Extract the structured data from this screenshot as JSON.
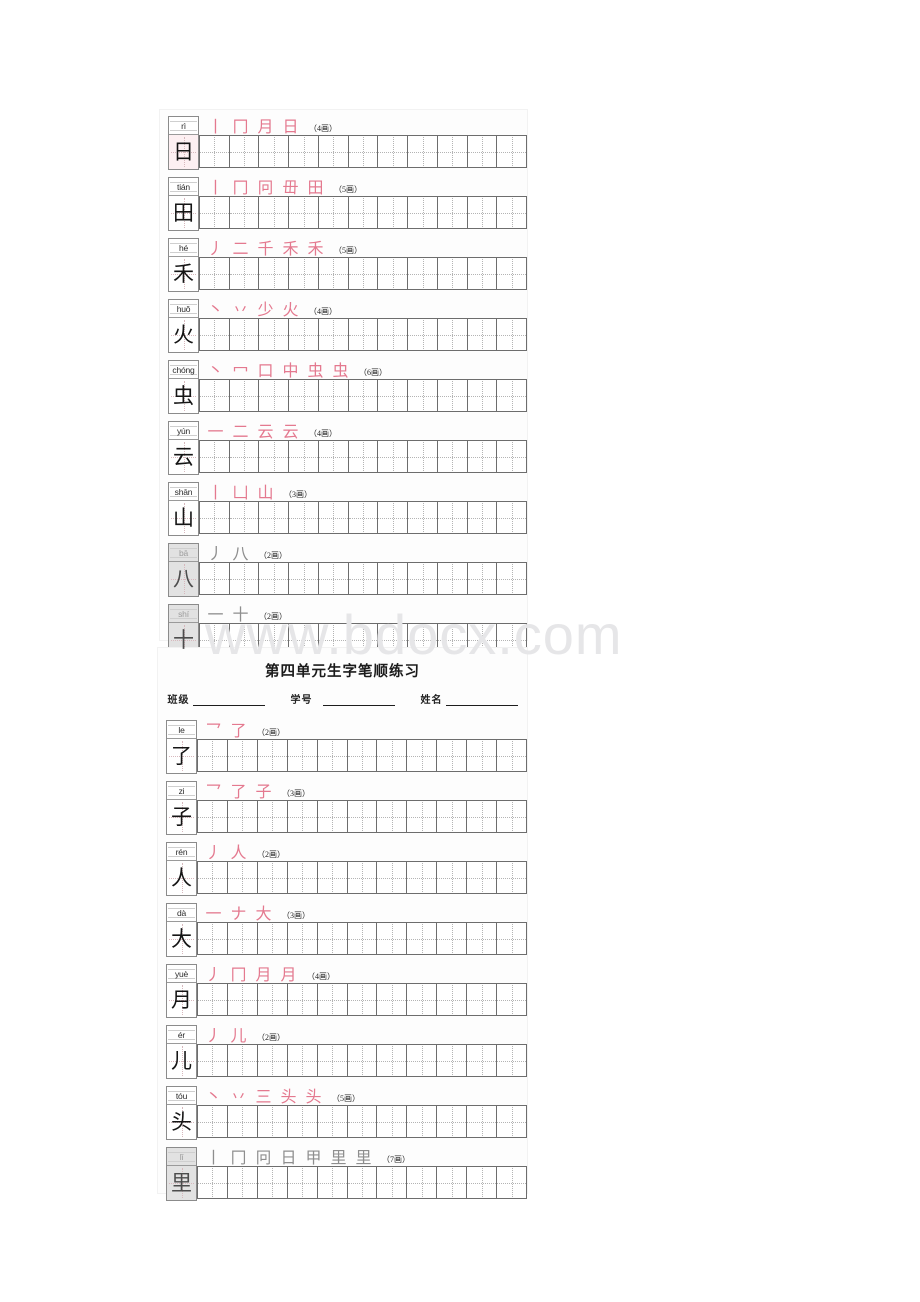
{
  "watermark": "www.bdocx.com",
  "colors": {
    "stroke_red": "#e4798f",
    "grid_line": "#6d6d6d",
    "guide_dotted": "#b4b4b4",
    "dim_background": "#e2e2e2",
    "tint_background": "#fdf0f2",
    "watermark_gray": "#e6e6e8"
  },
  "grid": {
    "cells_per_row": 11
  },
  "section_one": {
    "rows": [
      {
        "pinyin": "rì",
        "char": "日",
        "strokes": [
          "丨",
          "冂",
          "月",
          "日"
        ],
        "stroke_count": "（4画）",
        "dim": false,
        "tinted": true
      },
      {
        "pinyin": "tián",
        "char": "田",
        "strokes": [
          "丨",
          "冂",
          "冋",
          "毌",
          "田"
        ],
        "stroke_count": "（5画）",
        "dim": false,
        "tinted": false
      },
      {
        "pinyin": "hé",
        "char": "禾",
        "strokes": [
          "丿",
          "二",
          "千",
          "禾",
          "禾"
        ],
        "stroke_count": "（5画）",
        "dim": false,
        "tinted": false
      },
      {
        "pinyin": "huǒ",
        "char": "火",
        "strokes": [
          "丶",
          "丷",
          "少",
          "火"
        ],
        "stroke_count": "（4画）",
        "dim": false,
        "tinted": false
      },
      {
        "pinyin": "chóng",
        "char": "虫",
        "strokes": [
          "丶",
          "冖",
          "口",
          "中",
          "虫",
          "虫"
        ],
        "stroke_count": "（6画）",
        "dim": false,
        "tinted": false
      },
      {
        "pinyin": "yún",
        "char": "云",
        "strokes": [
          "一",
          "二",
          "云",
          "云"
        ],
        "stroke_count": "（4画）",
        "dim": false,
        "tinted": false
      },
      {
        "pinyin": "shān",
        "char": "山",
        "strokes": [
          "丨",
          "凵",
          "山"
        ],
        "stroke_count": "（3画）",
        "dim": false,
        "tinted": false
      },
      {
        "pinyin": "bā",
        "char": "八",
        "strokes": [
          "丿",
          "八"
        ],
        "stroke_count": "（2画）",
        "dim": true,
        "tinted": false
      },
      {
        "pinyin": "shí",
        "char": "十",
        "strokes": [
          "一",
          "十"
        ],
        "stroke_count": "（2画）",
        "dim": true,
        "tinted": false
      }
    ]
  },
  "section_two": {
    "title": "第四单元生字笔顺练习",
    "fields": [
      {
        "label": "班级"
      },
      {
        "label": "学号"
      },
      {
        "label": "姓名"
      }
    ],
    "rows": [
      {
        "pinyin": "le",
        "char": "了",
        "strokes": [
          "乛",
          "了"
        ],
        "stroke_count": "（2画）",
        "dim": false,
        "tinted": false
      },
      {
        "pinyin": "zi",
        "char": "子",
        "strokes": [
          "乛",
          "了",
          "子"
        ],
        "stroke_count": "（3画）",
        "dim": false,
        "tinted": false
      },
      {
        "pinyin": "rén",
        "char": "人",
        "strokes": [
          "丿",
          "人"
        ],
        "stroke_count": "（2画）",
        "dim": false,
        "tinted": false
      },
      {
        "pinyin": "dà",
        "char": "大",
        "strokes": [
          "一",
          "ナ",
          "大"
        ],
        "stroke_count": "（3画）",
        "dim": false,
        "tinted": false
      },
      {
        "pinyin": "yuè",
        "char": "月",
        "strokes": [
          "丿",
          "冂",
          "月",
          "月"
        ],
        "stroke_count": "（4画）",
        "dim": false,
        "tinted": false
      },
      {
        "pinyin": "ér",
        "char": "儿",
        "strokes": [
          "丿",
          "儿"
        ],
        "stroke_count": "（2画）",
        "dim": false,
        "tinted": false
      },
      {
        "pinyin": "tóu",
        "char": "头",
        "strokes": [
          "丶",
          "丷",
          "三",
          "头",
          "头"
        ],
        "stroke_count": "（5画）",
        "dim": false,
        "tinted": false
      },
      {
        "pinyin": "lǐ",
        "char": "里",
        "strokes": [
          "丨",
          "冂",
          "冋",
          "日",
          "甲",
          "里",
          "里"
        ],
        "stroke_count": "（7画）",
        "dim": true,
        "tinted": false
      }
    ]
  }
}
